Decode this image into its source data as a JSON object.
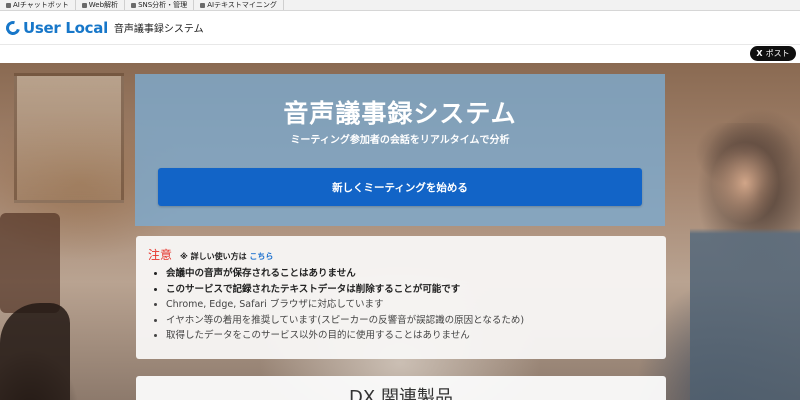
{
  "topbar": {
    "links": [
      {
        "label": "AIチャットボット"
      },
      {
        "label": "Web解析"
      },
      {
        "label": "SNS分析・管理"
      },
      {
        "label": "AIテキストマイニング"
      }
    ]
  },
  "header": {
    "brand": "User Local",
    "app_name": "音声議事録システム"
  },
  "share": {
    "x_label": "X",
    "post_label": "ポスト"
  },
  "hero": {
    "title": "音声議事録システム",
    "subtitle": "ミーティング参加者の会話をリアルタイムで分析",
    "start_button": "新しくミーティングを始める"
  },
  "notice": {
    "title": "注意",
    "help_prefix": "※ 詳しい使い方は",
    "help_link": "こちら",
    "items": [
      "会議中の音声が保存されることはありません",
      "このサービスで記録されたテキストデータは削除することが可能です",
      "Chrome, Edge, Safari ブラウザに対応しています",
      "イヤホン等の着用を推奨しています(スピーカーの反響音が誤認識の原因となるため)",
      "取得したデータをこのサービス以外の目的に使用することはありません"
    ]
  },
  "dx": {
    "title": "DX 関連製品"
  },
  "colors": {
    "brand": "#1777c9",
    "button": "#1264c7",
    "notice_title": "#e5332a",
    "link": "#1a6fce",
    "panel": "#7eaacd"
  }
}
